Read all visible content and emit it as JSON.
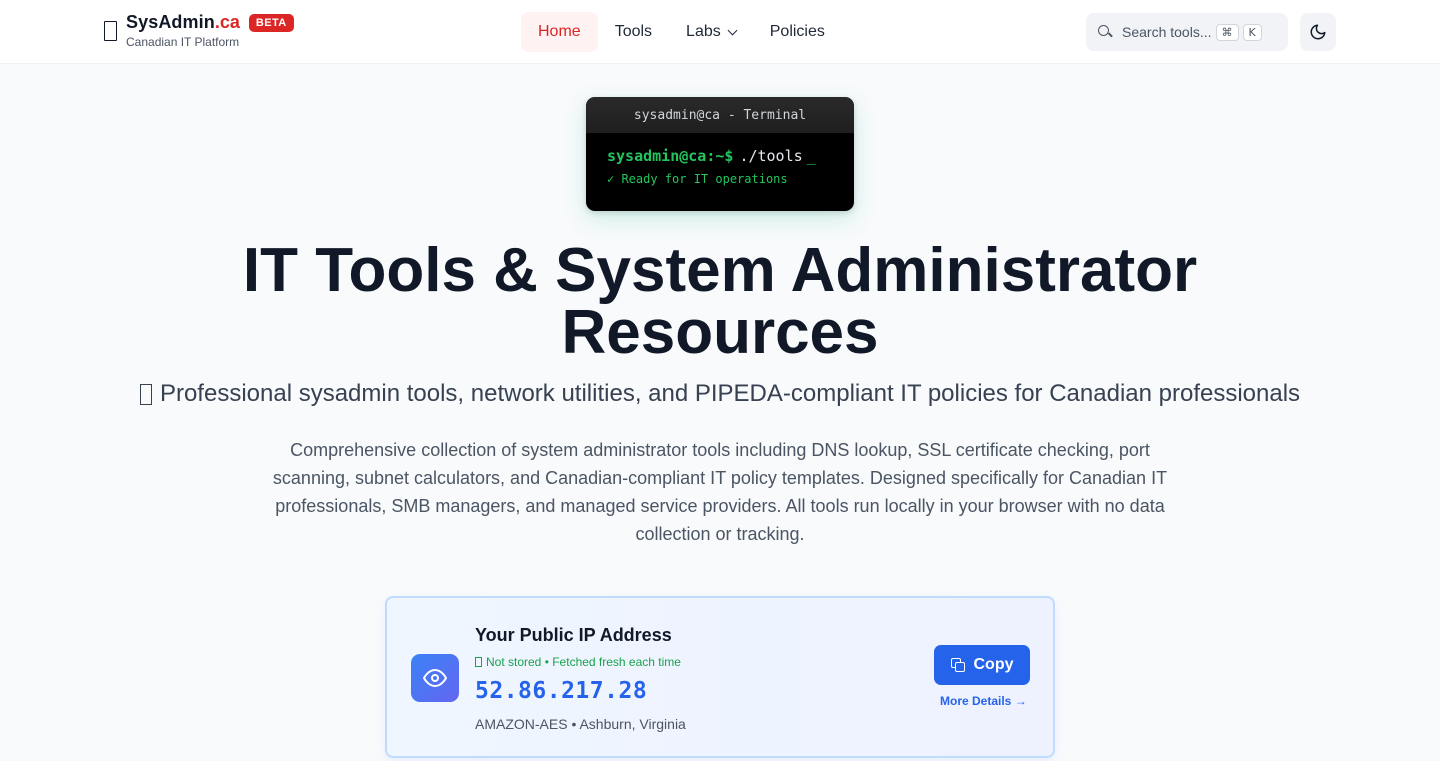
{
  "header": {
    "brand_name": "SysAdmin",
    "brand_tld": ".ca",
    "beta_badge": "BETA",
    "brand_subtitle": "Canadian IT Platform",
    "nav": [
      {
        "label": "Home",
        "active": true
      },
      {
        "label": "Tools",
        "active": false
      },
      {
        "label": "Labs",
        "active": false,
        "has_dropdown": true
      },
      {
        "label": "Policies",
        "active": false
      }
    ],
    "search": {
      "placeholder": "Search tools...",
      "shortcut_mod": "⌘",
      "shortcut_key": "K"
    },
    "theme_toggle_icon": "moon-icon"
  },
  "terminal": {
    "title": "sysadmin@ca - Terminal",
    "prompt_user": "sysadmin@ca",
    "prompt_path": ":~$",
    "command": "./tools",
    "cursor": "_",
    "status": "✓ Ready for IT operations"
  },
  "hero": {
    "title_line1": "IT Tools & System Administrator",
    "title_line2": "Resources",
    "subtitle": "Professional sysadmin tools, network utilities, and PIPEDA-compliant IT policies for Canadian professionals",
    "description": "Comprehensive collection of system administrator tools including DNS lookup, SSL certificate checking, port scanning, subnet calculators, and Canadian-compliant IT policy templates. Designed specifically for Canadian IT professionals, SMB managers, and managed service providers. All tools run locally in your browser with no data collection or tracking."
  },
  "ip_card": {
    "title": "Your Public IP Address",
    "privacy_note": "Not stored • Fetched fresh each time",
    "ip": "52.86.217.28",
    "location": "AMAZON-AES • Ashburn, Virginia",
    "copy_label": "Copy",
    "more_label": "More Details →"
  },
  "colors": {
    "accent_red": "#dc2626",
    "primary_blue": "#2563eb",
    "terminal_green": "#22c55e"
  }
}
